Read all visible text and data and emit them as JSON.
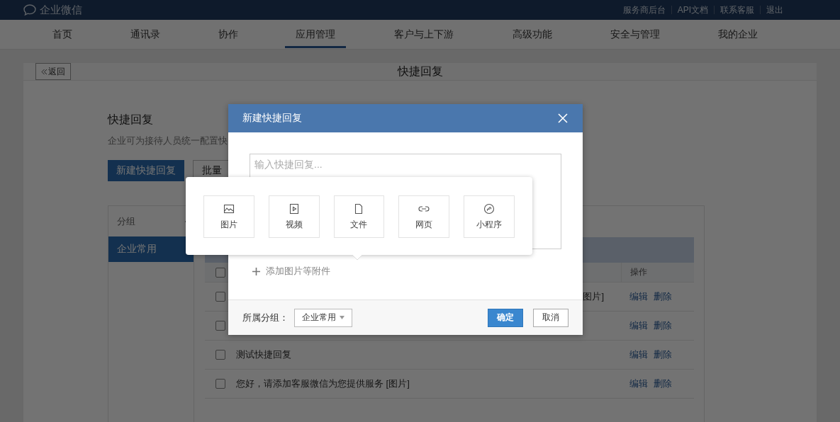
{
  "header": {
    "logo": "企业微信",
    "links": [
      "服务商后台",
      "API文档",
      "联系客服",
      "退出"
    ]
  },
  "nav": [
    {
      "label": "首页",
      "selected": false
    },
    {
      "label": "通讯录",
      "selected": false
    },
    {
      "label": "协作",
      "selected": false
    },
    {
      "label": "应用管理",
      "selected": true
    },
    {
      "label": "客户与上下游",
      "selected": false
    },
    {
      "label": "高级功能",
      "selected": false
    },
    {
      "label": "安全与管理",
      "selected": false
    },
    {
      "label": "我的企业",
      "selected": false
    }
  ],
  "page": {
    "back": "返回",
    "title": "快捷回复",
    "section_title": "快捷回复",
    "description": "企业可为接待人员统一配置快",
    "primary_button": "新建快捷回复",
    "secondary_button": "批量"
  },
  "groups": {
    "header": "分组",
    "items": [
      {
        "name": "企业常用",
        "selected": true
      }
    ]
  },
  "table": {
    "action_header": "操作",
    "all_checked": false,
    "rows": [
      {
        "text": "图片]",
        "checked": false,
        "actions": [
          "编辑",
          "删除"
        ]
      },
      {
        "checked": false,
        "actions": [
          "编辑",
          "删除"
        ]
      },
      {
        "text": "测试快捷回复",
        "checked": false,
        "actions": [
          "编辑",
          "删除"
        ]
      },
      {
        "text": "您好，请添加客服微信为您提供服务 [图片]",
        "checked": false,
        "actions": [
          "编辑",
          "删除"
        ]
      }
    ]
  },
  "modal": {
    "title": "新建快捷回复",
    "placeholder": "输入快捷回复...",
    "attach_label": "添加图片等附件",
    "group_label": "所属分组：",
    "group_value": "企业常用",
    "confirm": "确定",
    "cancel": "取消"
  },
  "attachments": [
    {
      "kind": "image",
      "label": "图片"
    },
    {
      "kind": "video",
      "label": "视频"
    },
    {
      "kind": "file",
      "label": "文件"
    },
    {
      "kind": "link",
      "label": "网页"
    },
    {
      "kind": "miniprogram",
      "label": "小程序"
    }
  ]
}
